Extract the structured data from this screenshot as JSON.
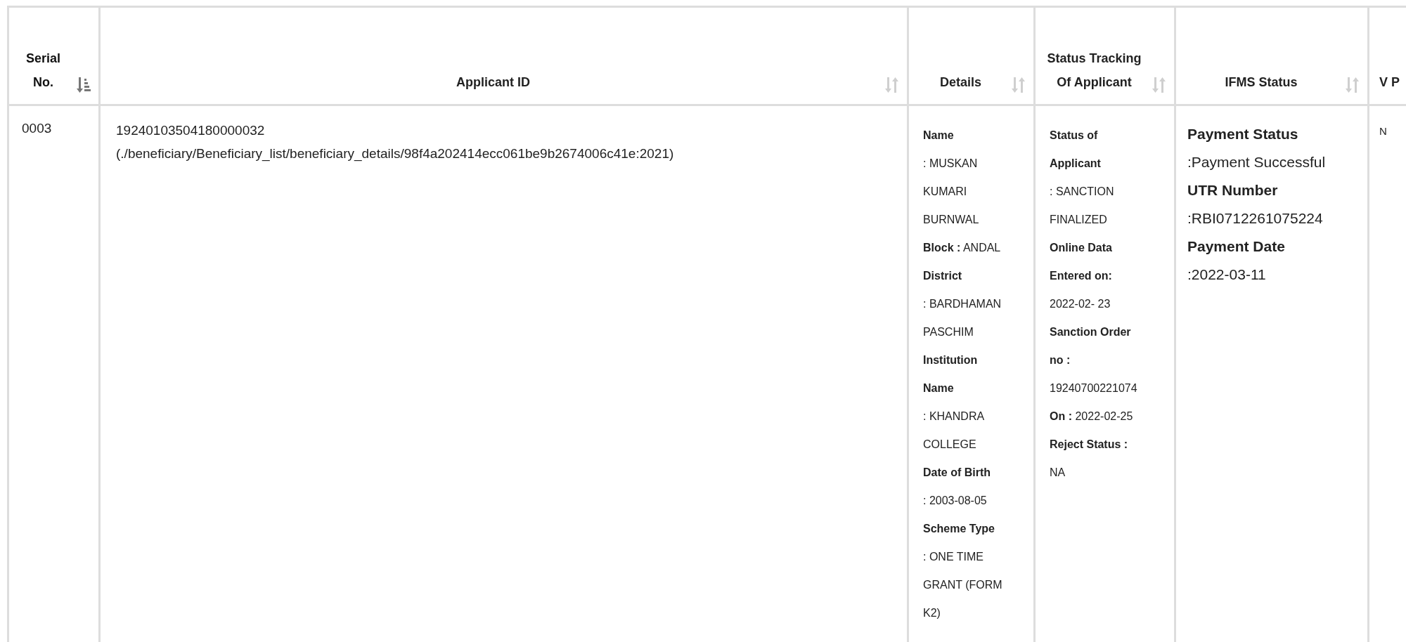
{
  "table": {
    "columns": [
      {
        "label": "Serial No.",
        "sortable": true,
        "selected": true
      },
      {
        "label": "Applicant ID",
        "sortable": true,
        "selected": false
      },
      {
        "label": "Details",
        "sortable": true,
        "selected": false
      },
      {
        "label": "Status Tracking Of Applicant",
        "sortable": true,
        "selected": false
      },
      {
        "label": "IFMS Status",
        "sortable": true,
        "selected": false
      },
      {
        "label": "V P",
        "sortable": false,
        "selected": false
      }
    ],
    "rows": [
      {
        "serial": "0003",
        "applicant_id": "19240103504180000032",
        "link": "(./beneficiary/Beneficiary_list/beneficiary_details/98f4a202414ecc061be9b2674006c41e:2021)",
        "details": [
          {
            "label": "Name",
            "value": ": MUSKAN KUMARI BURNWAL",
            "newline": true
          },
          {
            "label": "Block :",
            "value": "ANDAL",
            "newline": false
          },
          {
            "label": "District",
            "value": ": BARDHAMAN PASCHIM",
            "newline": true
          },
          {
            "label": "Institution Name",
            "value": ": KHANDRA COLLEGE",
            "newline": true
          },
          {
            "label": "Date of Birth",
            "value": ": 2003-08-05",
            "newline": true
          },
          {
            "label": "Scheme Type",
            "value": ": ONE TIME GRANT (FORM K2)",
            "newline": true
          }
        ],
        "status": [
          {
            "label": "Status of Applicant",
            "value": ": SANCTION FINALIZED",
            "newline": true
          },
          {
            "label": "Online Data Entered on:",
            "value": "2022-02- 23"
          },
          {
            "label": "Sanction Order no :",
            "value": "19240700221074"
          },
          {
            "label": "On :",
            "value": "2022-02-25",
            "newline": false
          },
          {
            "label": "Reject Status :",
            "value": "NA",
            "newline": true
          }
        ],
        "ifms": [
          {
            "label": "Payment Status",
            "value": ":Payment Successful",
            "newline": true
          },
          {
            "label": "UTR Number",
            "value": ":RBI0712261075224",
            "newline": true
          },
          {
            "label": "Payment Date",
            "value": ":2022-03-11",
            "newline": true
          }
        ],
        "column_6": "N"
      }
    ]
  }
}
